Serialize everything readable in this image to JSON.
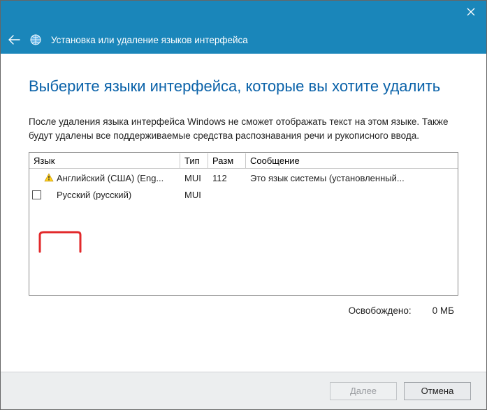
{
  "header": {
    "title": "Установка или удаление языков интерфейса"
  },
  "page": {
    "title": "Выберите языки интерфейса, которые вы хотите удалить",
    "description": "После удаления языка интерфейса Windows не сможет отображать текст на этом языке. Также будут удалены все поддерживаемые средства распознавания речи и рукописного ввода."
  },
  "columns": {
    "lang": "Язык",
    "type": "Тип",
    "size": "Разм",
    "msg": "Сообщение"
  },
  "rows": [
    {
      "name": "Английский (США) (Eng...",
      "type": "MUI",
      "size": "112",
      "msg": "Это язык системы (установленный...",
      "warning": true,
      "checkbox": false
    },
    {
      "name": "Русский (русский)",
      "type": "MUI",
      "size": "",
      "msg": "",
      "warning": false,
      "checkbox": true
    }
  ],
  "freed": {
    "label": "Освобождено:",
    "value": "0 МБ"
  },
  "buttons": {
    "next": "Далее",
    "cancel": "Отмена"
  },
  "icons": {
    "close": "close-icon",
    "back": "back-arrow-icon",
    "globe": "globe-icon",
    "warning": "warning-icon"
  }
}
